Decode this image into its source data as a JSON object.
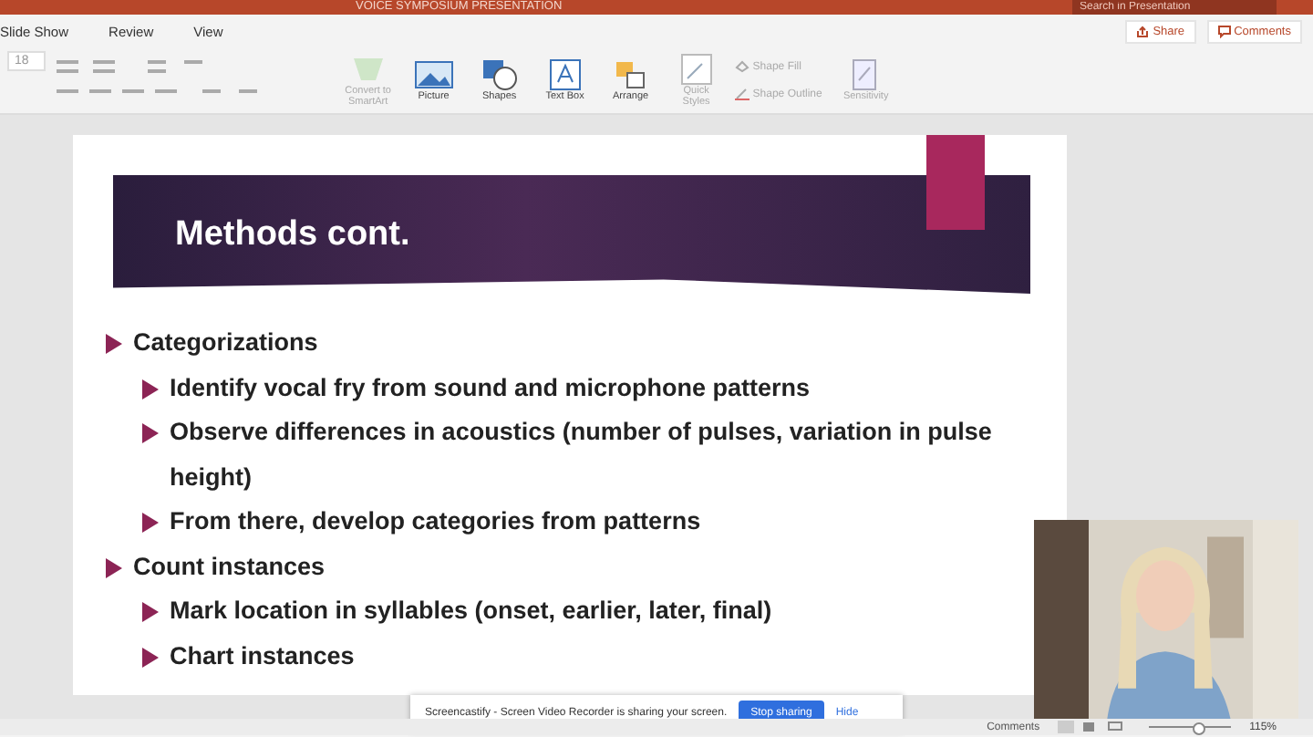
{
  "window": {
    "title": "VOICE SYMPOSIUM PRESENTATION",
    "search": {
      "placeholder": "Search in Presentation"
    }
  },
  "menu": [
    {
      "label": "Slide Show"
    },
    {
      "label": "Review"
    },
    {
      "label": "View"
    }
  ],
  "actions": [
    {
      "label": "Share",
      "kind": "share"
    },
    {
      "label": "Comments",
      "kind": "comments"
    }
  ],
  "ribbon": {
    "font_size": "18",
    "tools": [
      {
        "label": "Convert to SmartArt",
        "kind": "smartart",
        "disabled": true
      },
      {
        "label": "Picture",
        "kind": "picture",
        "disabled": false
      },
      {
        "label": "Shapes",
        "kind": "shapes",
        "disabled": false
      },
      {
        "label": "Text Box",
        "kind": "textbox",
        "disabled": false
      },
      {
        "label": "Arrange",
        "kind": "arrange",
        "disabled": false
      },
      {
        "label": "Quick Styles",
        "kind": "styles",
        "disabled": true
      }
    ],
    "shape_format": [
      {
        "label": "Shape Fill",
        "kind": "fill"
      },
      {
        "label": "Shape Outline",
        "kind": "outline"
      }
    ],
    "sensitivity": "Sensitivity"
  },
  "slide": {
    "title": "Methods cont.",
    "bullets": [
      {
        "text": "Categorizations",
        "children": [
          {
            "text": "Identify vocal fry from sound and microphone patterns"
          },
          {
            "text": "Observe differences in acoustics (number of pulses, variation in pulse height)"
          },
          {
            "text": "From there, develop categories from patterns"
          }
        ]
      },
      {
        "text": "Count instances",
        "children": [
          {
            "text": "Mark location in syllables (onset, earlier, later, final)"
          },
          {
            "text": "Chart instances"
          }
        ]
      }
    ]
  },
  "share_bar": {
    "text": "Screencastify - Screen Video Recorder is sharing your screen.",
    "stop": "Stop sharing",
    "hide": "Hide"
  },
  "status_bar": {
    "comments": "Comments",
    "zoom": {
      "level": 0.6,
      "reading": "115%"
    }
  }
}
